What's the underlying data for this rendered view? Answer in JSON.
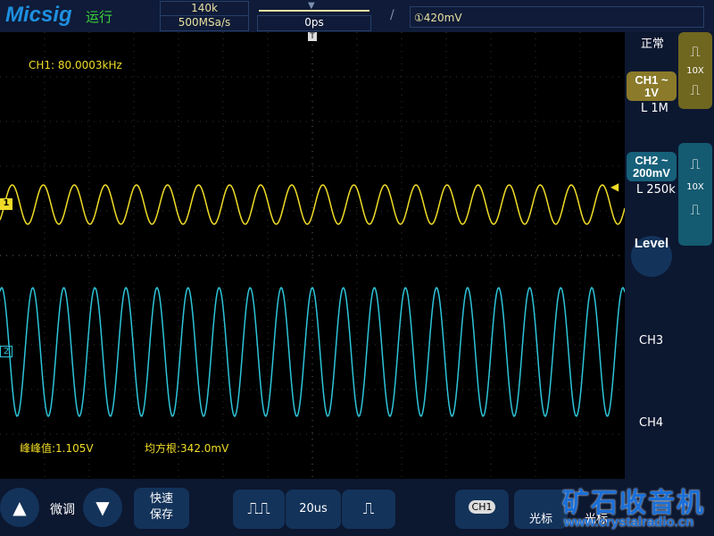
{
  "header": {
    "logo": "Micsig",
    "run_state": "运行",
    "memory_depth": "140k",
    "sample_rate": "500MSa/s",
    "trigger_position": "0ps",
    "trigger_edge_icon": "rising-edge-icon",
    "trigger_level": "①420mV"
  },
  "plot": {
    "measure_freq": "CH1: 80.0003kHz",
    "peak_to_peak": "峰峰值:1.105V",
    "rms": "均方根:342.0mV",
    "ch1_marker": "1",
    "ch2_marker": "2",
    "trigger_marker": "T"
  },
  "side": {
    "mode": "正常",
    "ch1": {
      "name": "CH1 ~",
      "scale": "1V",
      "impedance": "L 1M",
      "probe": "10X",
      "color": "#8a7a2a"
    },
    "ch2": {
      "name": "CH2 ~",
      "scale": "200mV",
      "impedance": "L 250k",
      "probe": "10X",
      "color": "#17607a"
    },
    "level": "Level",
    "ch3": "CH3",
    "ch4": "CH4"
  },
  "bottom": {
    "fine": "微调",
    "quick_save": "快速\n保存",
    "timebase": "20us",
    "ch_select": "CH1",
    "cursor1": "光标",
    "cursor2": "光标"
  },
  "colors": {
    "ch1": "#f0dc28",
    "ch2": "#2ec4d8"
  },
  "watermark": {
    "title": "矿石收音机",
    "url": "www.crystalradio.cn"
  }
}
